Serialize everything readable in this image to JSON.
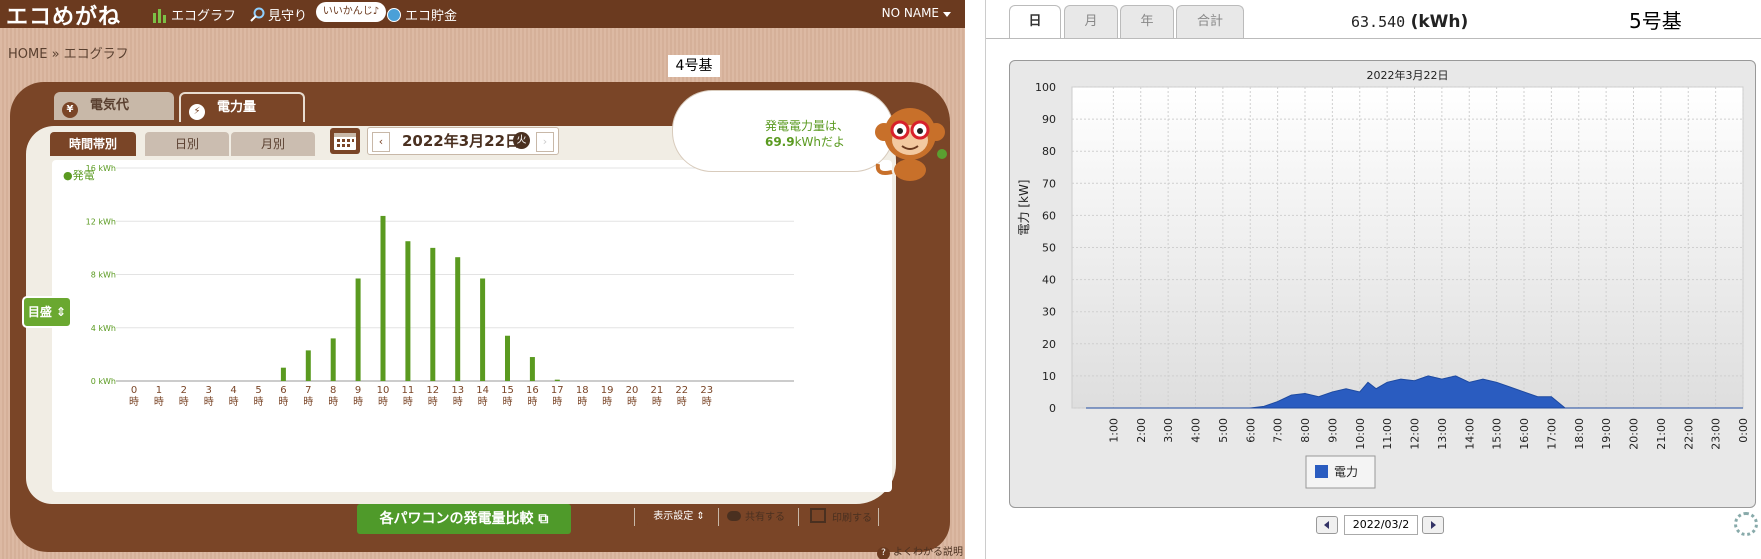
{
  "left_app": {
    "brand": "エコめがね",
    "nav": [
      {
        "label": "エコグラフ",
        "icon": "bar-chart-icon"
      },
      {
        "label": "見守り",
        "icon": "magnifier-icon"
      },
      {
        "label": "エコ貯金",
        "icon": "coin-icon"
      }
    ],
    "pill": "いいかんじ♪",
    "user": "NO NAME",
    "breadcrumb": "HOME » エコグラフ",
    "overlay_label": "4号基",
    "tabs": [
      {
        "label": "電気代",
        "icon": "yen-icon",
        "icon_glyph": "¥"
      },
      {
        "label": "電力量",
        "icon": "bolt-icon",
        "icon_glyph": "⚡"
      }
    ],
    "subtabs": [
      "時間帯別",
      "日別",
      "月別"
    ],
    "date": {
      "prev": "‹",
      "text": "2022年3月22日",
      "weekday": "火",
      "next": "›"
    },
    "bubble": {
      "line1": "発電電力量は、",
      "value": "69.9",
      "unit_text": "kWhだよ"
    },
    "series_label": "●発電",
    "target_button": "目盛 ⇕",
    "compare_button": "各パワコンの発電量比較 ⧉",
    "display_settings": "表示設定 ⇕",
    "share": "共有する",
    "print": "印刷する",
    "help": "よくわかる説明"
  },
  "right_app": {
    "tabs": [
      "日",
      "月",
      "年",
      "合計"
    ],
    "total": "63.540",
    "total_unit": "(kWh)",
    "overlay_label": "5号基",
    "date_input": "2022/03/2"
  },
  "chart_data": [
    {
      "type": "bar",
      "title": "",
      "series": [
        {
          "name": "発電",
          "color": "#5a9a20",
          "values": [
            0,
            0,
            0,
            0,
            0,
            0,
            1.0,
            2.3,
            3.2,
            7.7,
            12.4,
            10.5,
            10.0,
            9.3,
            7.7,
            3.4,
            1.8,
            0.1,
            0,
            0,
            0,
            0,
            0,
            0
          ]
        }
      ],
      "categories": [
        "0時",
        "1時",
        "2時",
        "3時",
        "4時",
        "5時",
        "6時",
        "7時",
        "8時",
        "9時",
        "10時",
        "11時",
        "12時",
        "13時",
        "14時",
        "15時",
        "16時",
        "17時",
        "18時",
        "19時",
        "20時",
        "21時",
        "22時",
        "23時"
      ],
      "ylim": [
        0,
        16
      ],
      "yticks": [
        "0 kWh",
        "4 kWh",
        "8 kWh",
        "12 kWh",
        "16 kWh"
      ],
      "ytick_values": [
        0,
        4,
        8,
        12,
        16
      ]
    },
    {
      "type": "area",
      "title": "2022年3月22日",
      "ylabel": "電力 [kW]",
      "ylim": [
        0,
        100
      ],
      "yticks": [
        0,
        10,
        20,
        30,
        40,
        50,
        60,
        70,
        80,
        90,
        100
      ],
      "xticks": [
        "1:00",
        "2:00",
        "3:00",
        "4:00",
        "5:00",
        "6:00",
        "7:00",
        "8:00",
        "9:00",
        "10:00",
        "11:00",
        "12:00",
        "13:00",
        "14:00",
        "15:00",
        "16:00",
        "17:00",
        "18:00",
        "19:00",
        "20:00",
        "21:00",
        "22:00",
        "23:00",
        "0:00"
      ],
      "legend": "電力",
      "series": [
        {
          "name": "電力",
          "color": "#2a5cc0",
          "x": [
            0,
            1,
            2,
            3,
            4,
            5,
            6,
            6.5,
            7,
            7.5,
            8,
            8.5,
            9,
            9.5,
            10,
            10.3,
            10.6,
            11,
            11.5,
            12,
            12.5,
            13,
            13.5,
            14,
            14.5,
            15,
            15.5,
            16,
            16.5,
            17,
            17.5,
            24
          ],
          "y": [
            0,
            0,
            0,
            0,
            0,
            0,
            0,
            0.5,
            2,
            4,
            4.5,
            3.5,
            5,
            6,
            5,
            8,
            6,
            8,
            9,
            8.5,
            10,
            9,
            10,
            8,
            9,
            8,
            6.5,
            5,
            3.5,
            3.5,
            0,
            0
          ]
        }
      ]
    }
  ]
}
